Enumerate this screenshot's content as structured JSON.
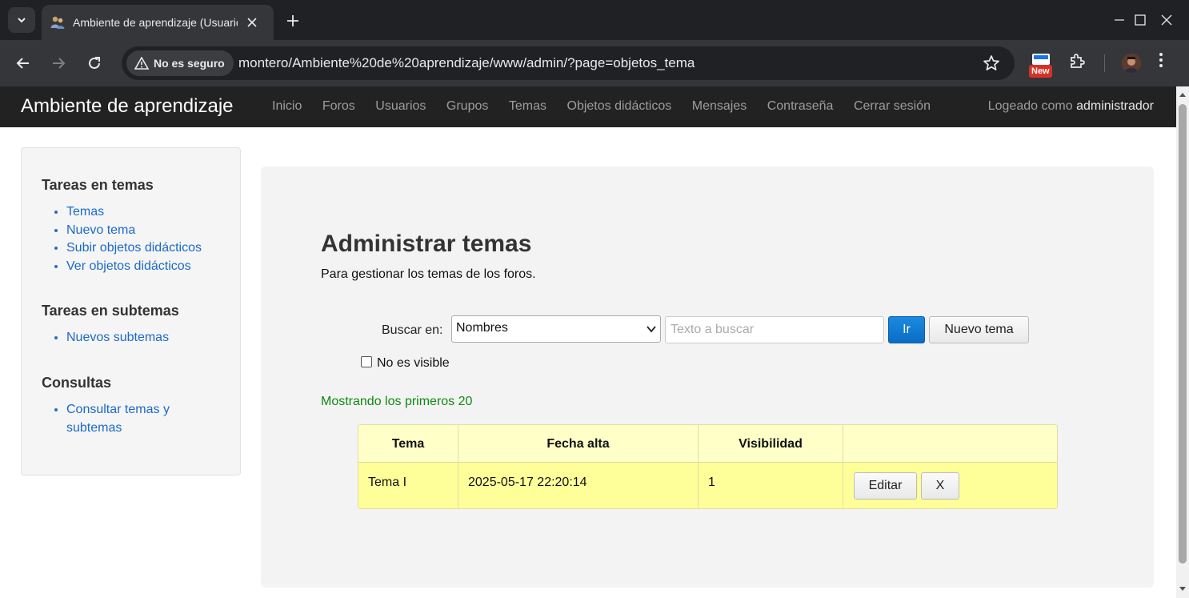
{
  "browser": {
    "tab_title": "Ambiente de aprendizaje (Usuario",
    "security_label": "No es seguro",
    "url": "montero/Ambiente%20de%20aprendizaje/www/admin/?page=objetos_tema",
    "new_badge": "New"
  },
  "site": {
    "brand": "Ambiente de aprendizaje",
    "nav": [
      {
        "label": "Inicio"
      },
      {
        "label": "Foros"
      },
      {
        "label": "Usuarios"
      },
      {
        "label": "Grupos"
      },
      {
        "label": "Temas"
      },
      {
        "label": "Objetos didácticos"
      },
      {
        "label": "Mensajes"
      },
      {
        "label": "Contraseña"
      },
      {
        "label": "Cerrar sesión"
      }
    ],
    "logged_prefix": "Logeado como",
    "logged_user": "administrador"
  },
  "sidebar": {
    "sections": [
      {
        "heading": "Tareas en temas",
        "items": [
          "Temas",
          "Nuevo tema",
          "Subir objetos didácticos",
          "Ver objetos didácticos"
        ]
      },
      {
        "heading": "Tareas en subtemas",
        "items": [
          "Nuevos subtemas"
        ]
      },
      {
        "heading": "Consultas",
        "items": [
          "Consultar temas y subtemas"
        ]
      }
    ]
  },
  "main": {
    "title": "Administrar temas",
    "description": "Para gestionar los temas de los foros.",
    "search": {
      "label": "Buscar en:",
      "selected": "Nombres",
      "placeholder": "Texto a buscar",
      "go_label": "Ir",
      "new_label": "Nuevo tema",
      "checkbox_label": "No es visible"
    },
    "showing": "Mostrando los primeros 20",
    "table": {
      "headers": [
        "Tema",
        "Fecha alta",
        "Visibilidad",
        ""
      ],
      "rows": [
        {
          "tema": "Tema I",
          "fecha": "2025-05-17 22:20:14",
          "visibilidad": "1",
          "edit_label": "Editar",
          "delete_label": "X"
        }
      ]
    }
  }
}
